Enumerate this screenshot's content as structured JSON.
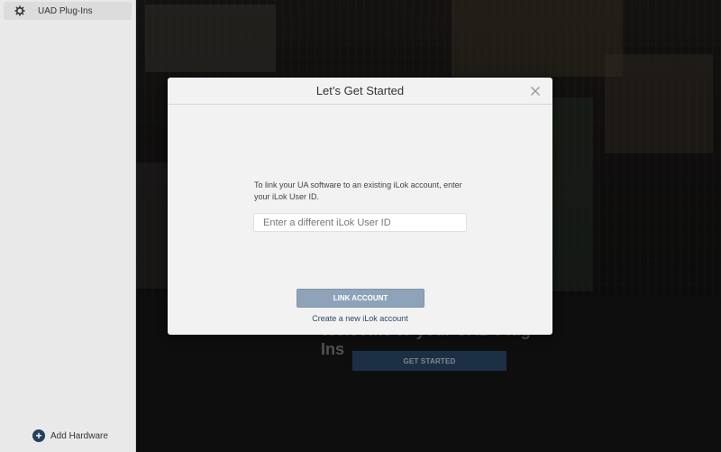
{
  "sidebar": {
    "items": [
      {
        "label": "UAD Plug-Ins",
        "icon": "gear-icon"
      }
    ],
    "add_hardware_label": "Add Hardware"
  },
  "background": {
    "welcome_title": "Welcome to your UAD Plug-Ins",
    "get_started_label": "GET STARTED"
  },
  "modal": {
    "title": "Let’s Get Started",
    "description": "To link your UA software to an existing iLok account, enter your iLok User ID.",
    "input_placeholder": "Enter a different iLok User ID",
    "input_value": "",
    "link_button_label": "LINK ACCOUNT",
    "create_link_label": "Create a new iLok account"
  },
  "colors": {
    "accent": "#23405f",
    "button_disabled": "#8ea3b9",
    "sidebar_bg": "#e9e9e9",
    "modal_bg": "#f2f2f2"
  }
}
